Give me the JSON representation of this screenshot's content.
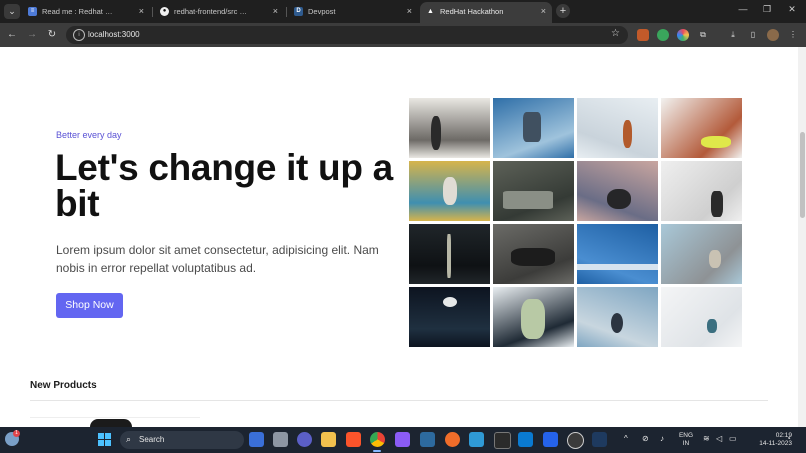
{
  "browser": {
    "tabs": [
      {
        "title": "Read me : Redhat Hackathon - ...",
        "active": false,
        "favicon": "document-icon"
      },
      {
        "title": "redhat-frontend/src at main · s...",
        "active": false,
        "favicon": "github-icon"
      },
      {
        "title": "Devpost",
        "active": false,
        "favicon": "devpost-icon"
      },
      {
        "title": "RedHat Hackathon",
        "active": true,
        "favicon": "triangle-icon"
      }
    ],
    "address": "localhost:3000",
    "close_glyph": "×",
    "new_tab_glyph": "+",
    "colors": {
      "chrome_dark": "#1f1f1f",
      "toolbar": "#3c3c3c",
      "omnibox": "#282828"
    }
  },
  "hero": {
    "eyebrow": "Better every day",
    "title": "Let's change it up a bit",
    "description": "Lorem ipsum dolor sit amet consectetur, adipisicing elit. Nam nobis in error repellat voluptatibus ad.",
    "cta_label": "Shop Now",
    "accent_color": "#6366f1"
  },
  "gallery": {
    "images": [
      {
        "name": "volleyball-players-photo",
        "colors": [
          "#e9e7e2",
          "#6d6a66",
          "#2a2a2a"
        ]
      },
      {
        "name": "basketball-through-fence-photo",
        "colors": [
          "#2f6fa8",
          "#9fc3dc",
          "#405060"
        ]
      },
      {
        "name": "basketball-shooter-photo",
        "colors": [
          "#e8eef2",
          "#c9d3db",
          "#b25a2b"
        ]
      },
      {
        "name": "tennis-shoes-ball-photo",
        "colors": [
          "#f2f2f0",
          "#b35a3a",
          "#dfe84a"
        ]
      },
      {
        "name": "rock-climber-wall-photo",
        "colors": [
          "#d6b44c",
          "#3f8fb0",
          "#e0dcd4"
        ]
      },
      {
        "name": "climbing-rock-face-photo",
        "colors": [
          "#5d6158",
          "#343a35",
          "#8a8f86"
        ]
      },
      {
        "name": "yoga-silhouette-sunset-photo",
        "colors": [
          "#c9a6a0",
          "#6a6d86",
          "#262628"
        ]
      },
      {
        "name": "kettlebell-shadow-photo",
        "colors": [
          "#efefef",
          "#cfcfcf",
          "#2a2a2a"
        ]
      },
      {
        "name": "night-pole-dark-photo",
        "colors": [
          "#20262a",
          "#0e1114",
          "#b7b7a6"
        ]
      },
      {
        "name": "weightlifter-barbell-photo",
        "colors": [
          "#6b6b67",
          "#3c3c3a",
          "#1c1c1c"
        ]
      },
      {
        "name": "swimming-pool-lanes-photo",
        "colors": [
          "#1e5fa3",
          "#4a8ed1",
          "#d6e3ef"
        ]
      },
      {
        "name": "skatepark-bowl-photo",
        "colors": [
          "#a9c8d8",
          "#8e9295",
          "#c9c2b3"
        ]
      },
      {
        "name": "stadium-lights-night-photo",
        "colors": [
          "#0d1420",
          "#1f3040",
          "#e6e8e8"
        ]
      },
      {
        "name": "soccer-player-celebration-photo",
        "colors": [
          "#e9eef1",
          "#1f2a35",
          "#b8c9a5"
        ]
      },
      {
        "name": "cyclist-horizon-photo",
        "colors": [
          "#7fa6c2",
          "#c8d6df",
          "#2b3440"
        ]
      },
      {
        "name": "snowboarder-jump-photo",
        "colors": [
          "#f4f5f6",
          "#dfe3e7",
          "#3b6f80"
        ]
      }
    ]
  },
  "products": {
    "section_title": "New Products"
  },
  "taskbar": {
    "search_label": "Search",
    "notification_count": "1",
    "language_line1": "ENG",
    "language_line2": "IN",
    "time": "02:19",
    "date": "14-11-2023"
  }
}
